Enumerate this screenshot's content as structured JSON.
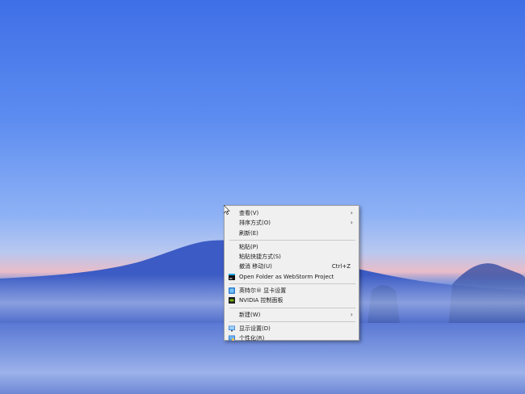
{
  "context_menu": {
    "items": [
      {
        "label": "查看(V)"
      },
      {
        "label": "排序方式(O)"
      },
      {
        "label": "刷新(E)"
      },
      {
        "label": "粘贴(P)"
      },
      {
        "label": "粘贴快捷方式(S)"
      },
      {
        "label": "撤消 移动(U)",
        "shortcut": "Ctrl+Z"
      },
      {
        "label": "Open Folder as WebStorm Project",
        "icon": "webstorm-icon"
      },
      {
        "label": "英特尔® 显卡设置",
        "icon": "intel-graphics-icon"
      },
      {
        "label": "NVIDIA 控制面板",
        "icon": "nvidia-icon"
      },
      {
        "label": "新建(W)"
      },
      {
        "label": "显示设置(D)",
        "icon": "display-settings-icon"
      },
      {
        "label": "个性化(R)",
        "icon": "personalize-icon"
      }
    ]
  },
  "colors": {
    "menu_background": "#f0f0f0",
    "menu_border": "#a0a0a0",
    "sky_top": "#3f6fe6",
    "horizon_glow": "#e9bcc8"
  }
}
